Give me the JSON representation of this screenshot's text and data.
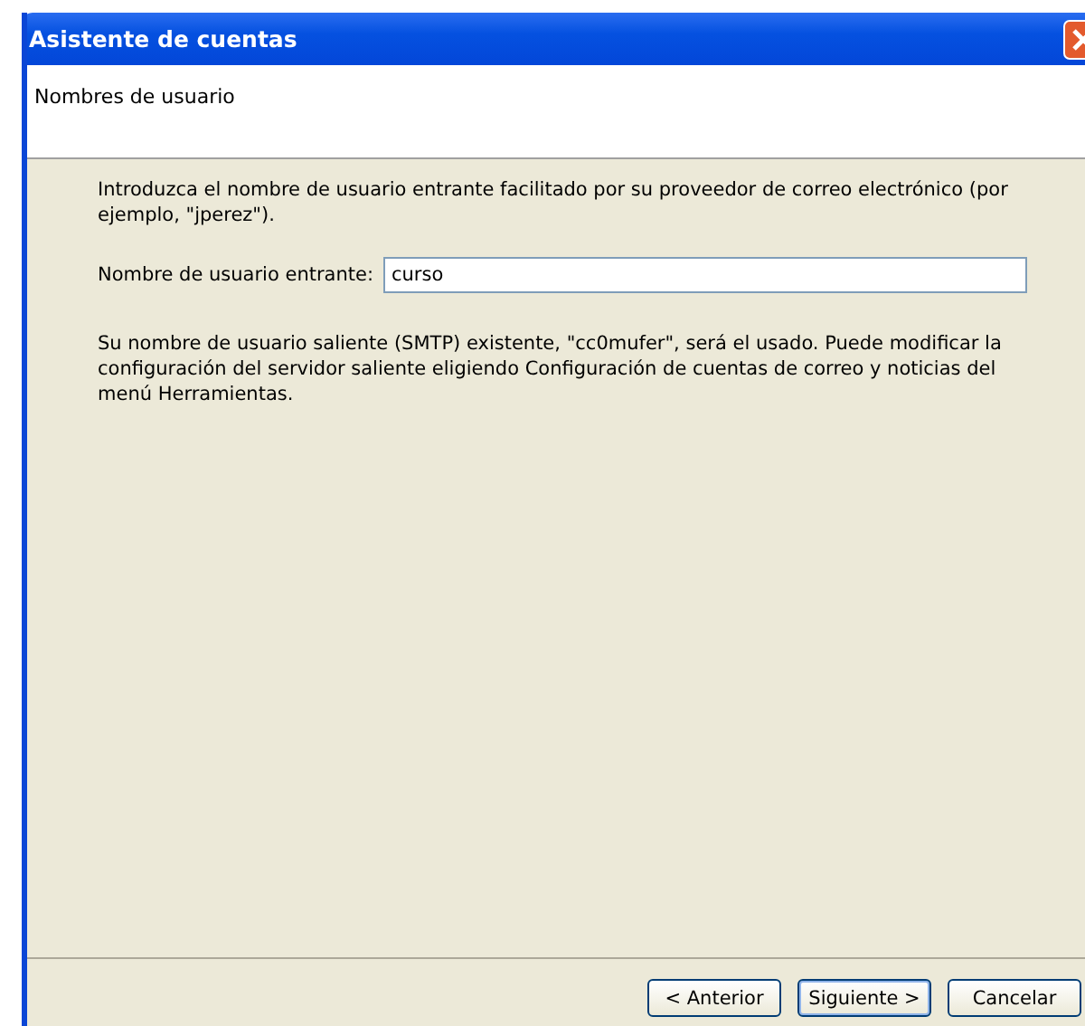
{
  "window": {
    "title": "Asistente de cuentas"
  },
  "page": {
    "heading": "Nombres de usuario"
  },
  "intro": "Introduzca el nombre de usuario entrante facilitado por su proveedor de correo electrónico (por ejemplo, \"jperez\").",
  "incoming_username": {
    "label": "Nombre de usuario entrante:",
    "value": "curso"
  },
  "note": "Su nombre de usuario saliente (SMTP) existente, \"cc0mufer\", será el usado. Puede modificar la configuración del servidor saliente eligiendo Configuración de cuentas de correo y noticias del menú Herramientas.",
  "buttons": [
    {
      "label": "< Anterior",
      "default": false
    },
    {
      "label": "Siguiente >",
      "default": true
    },
    {
      "label": "Cancelar",
      "default": false
    }
  ]
}
